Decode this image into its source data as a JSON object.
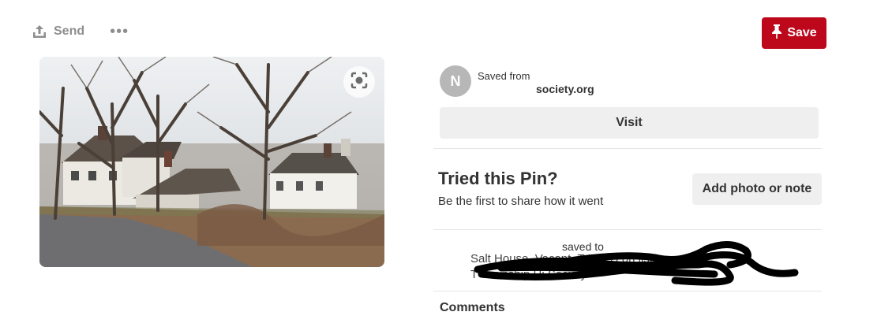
{
  "toolbar": {
    "send_label": "Send",
    "more_label": "•••",
    "save_label": "Save",
    "accent_color": "#bd081c"
  },
  "source": {
    "avatar_letter": "N",
    "saved_from_label": "Saved from",
    "domain": "society.org"
  },
  "visit_label": "Visit",
  "tried": {
    "title": "Tried this Pin?",
    "subtitle": "Be the first to share how it went",
    "add_label": "Add photo or note"
  },
  "board": {
    "saved_to_label": "saved to",
    "line1": "Salt House, Vacant, T       Her        H       on list",
    "line2": "T            Township Hi          Society"
  },
  "comments_label": "Comments",
  "icons": {
    "send": "upload-icon",
    "lens": "visual-search-icon",
    "pin": "pushpin-icon"
  }
}
